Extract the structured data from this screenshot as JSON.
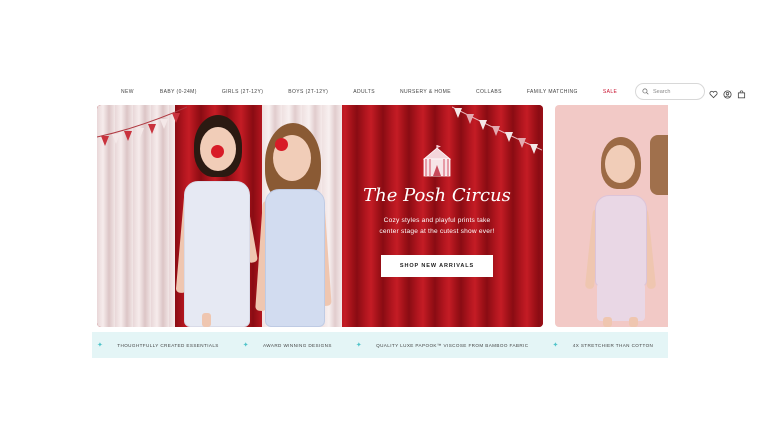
{
  "nav": {
    "links": [
      "NEW",
      "BABY (0-24M)",
      "GIRLS (2T-12Y)",
      "BOYS (2T-12Y)",
      "ADULTS",
      "NURSERY & HOME",
      "COLLABS",
      "FAMILY MATCHING",
      "SALE"
    ],
    "search_placeholder": "Search",
    "icons": [
      "heart-icon",
      "account-icon",
      "bag-icon"
    ]
  },
  "hero": {
    "title": "The Posh Circus",
    "subtitle_line1": "Cozy styles and playful prints take",
    "subtitle_line2": "center stage at the cutest show ever!",
    "cta": "SHOP NEW ARRIVALS",
    "icon": "circus-tent-icon"
  },
  "strip": {
    "items": [
      "THOUGHTFULLY CREATED ESSENTIALS",
      "AWARD WINNING DESIGNS",
      "QUALITY LUXE PAPOOK™ VISCOSE FROM BAMBOO FABRIC",
      "4X STRETCHIER THAN COTTON"
    ]
  },
  "colors": {
    "sale": "#c8102e",
    "hero_bg": "#a5121a",
    "strip_bg": "#e4f5f6",
    "sparkle": "#4ec3c9"
  }
}
